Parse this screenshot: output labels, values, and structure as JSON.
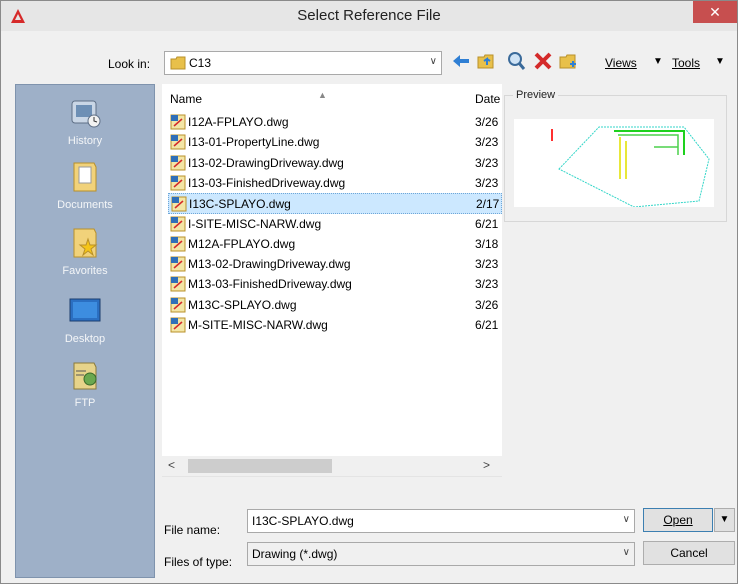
{
  "window": {
    "title": "Select Reference File",
    "close_glyph": "✕"
  },
  "toolbar": {
    "look_in_label": "Look in:",
    "look_in_value": "C13",
    "views_label": "Views",
    "tools_label": "Tools"
  },
  "places": [
    {
      "label": "History",
      "icon": "history-icon"
    },
    {
      "label": "Documents",
      "icon": "documents-folder-icon"
    },
    {
      "label": "Favorites",
      "icon": "favorites-folder-icon"
    },
    {
      "label": "Desktop",
      "icon": "desktop-icon"
    },
    {
      "label": "FTP",
      "icon": "ftp-icon"
    }
  ],
  "file_list": {
    "columns": {
      "name": "Name",
      "date": "Date"
    },
    "files": [
      {
        "name": "I12A-FPLAYO.dwg",
        "date": "3/26"
      },
      {
        "name": "I13-01-PropertyLine.dwg",
        "date": "3/23"
      },
      {
        "name": "I13-02-DrawingDriveway.dwg",
        "date": "3/23"
      },
      {
        "name": "I13-03-FinishedDriveway.dwg",
        "date": "3/23"
      },
      {
        "name": "I13C-SPLAYO.dwg",
        "date": "2/17",
        "selected": true
      },
      {
        "name": "I-SITE-MISC-NARW.dwg",
        "date": "6/21"
      },
      {
        "name": "M12A-FPLAYO.dwg",
        "date": "3/18"
      },
      {
        "name": "M13-02-DrawingDriveway.dwg",
        "date": "3/23"
      },
      {
        "name": "M13-03-FinishedDriveway.dwg",
        "date": "3/23"
      },
      {
        "name": "M13C-SPLAYO.dwg",
        "date": "3/26"
      },
      {
        "name": "M-SITE-MISC-NARW.dwg",
        "date": "6/21"
      }
    ]
  },
  "preview": {
    "label": "Preview"
  },
  "form": {
    "file_name_label": "File name:",
    "file_name_value": "I13C-SPLAYO.dwg",
    "file_type_label": "Files of type:",
    "file_type_value": "Drawing (*.dwg)",
    "open_label": "Open",
    "cancel_label": "Cancel"
  },
  "colors": {
    "selection": "#cce8ff",
    "places_panel": "#9eb0c8",
    "close_button": "#c74f4f"
  }
}
